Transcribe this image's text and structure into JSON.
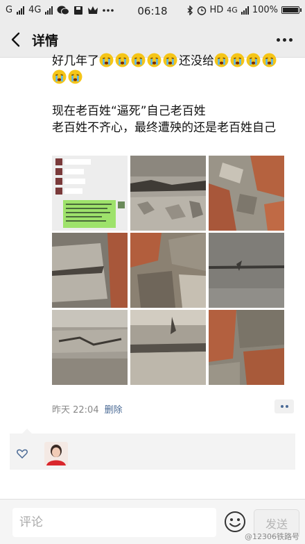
{
  "status_bar": {
    "carrier_label": "G",
    "network_label": "4G",
    "time": "06:18",
    "signal_hd_label": "HD",
    "network2_label": "4G",
    "battery_label": "100%"
  },
  "nav": {
    "title": "详情",
    "back_icon": "chevron-left-icon",
    "more_icon": "more-icon"
  },
  "post": {
    "line1_prefix": "好几年了",
    "line1_mid": "还没给",
    "emoji_icon": "crying-emoji-icon",
    "paragraph2_line1": "现在老百姓“逼死”自己老百姓",
    "paragraph2_line2": "老百姓不齐心，最终遭殃的还是老百姓自己",
    "photo_count": 9,
    "timestamp": "昨天 22:04",
    "delete_label": "删除"
  },
  "likes": {
    "icon": "heart-icon",
    "liker_avatar": "avatar"
  },
  "comment_bar": {
    "placeholder": "评论",
    "emoji_icon": "smiley-icon",
    "send_label": "发送"
  },
  "watermark": "@12306铁路号",
  "colors": {
    "bar_bg": "#ececec",
    "link_blue": "#4a6a95",
    "emoji_yellow": "#f5c518"
  }
}
